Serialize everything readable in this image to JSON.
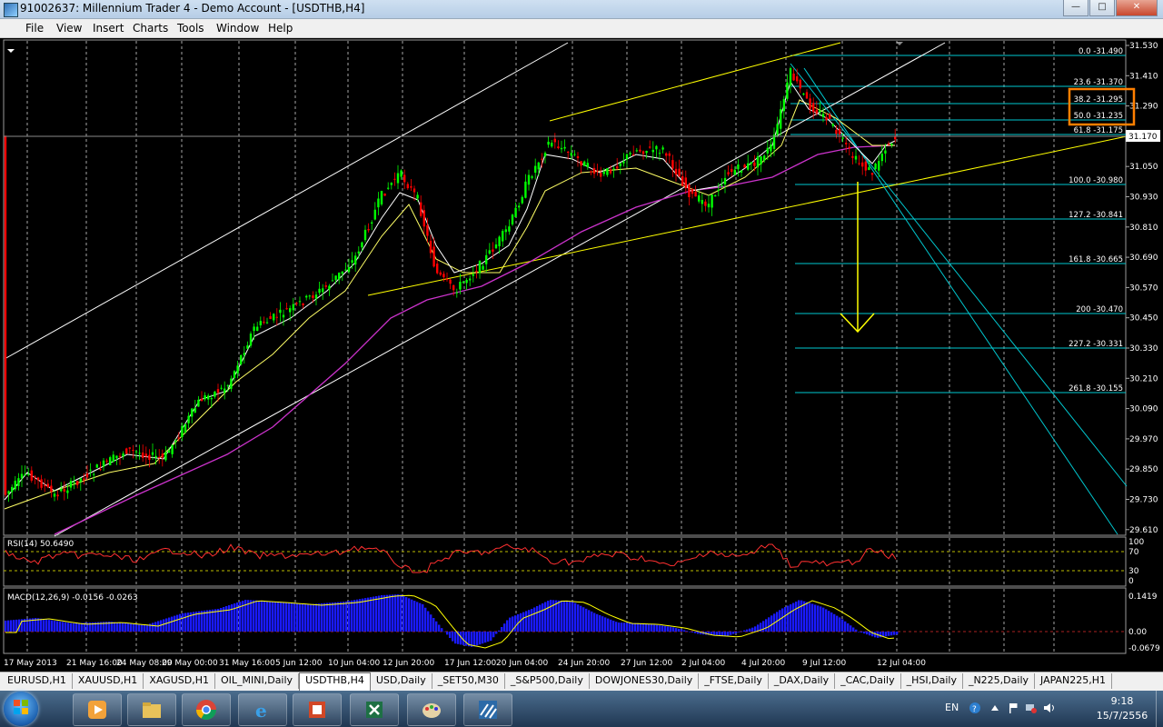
{
  "window": {
    "title": "91002637: Millennium Trader 4 - Demo Account - [USDTHB,H4]"
  },
  "menu": [
    "File",
    "View",
    "Insert",
    "Charts",
    "Tools",
    "Window",
    "Help"
  ],
  "chart": {
    "price_ticks": [
      "31.530",
      "31.410",
      "31.290",
      "31.170",
      "31.050",
      "30.930",
      "30.810",
      "30.690",
      "30.570",
      "30.450",
      "30.330",
      "30.210",
      "30.090",
      "29.970",
      "29.850",
      "29.730",
      "29.610"
    ],
    "current_price": "31.170",
    "fib_labels": [
      "0.0 -31.490",
      "23.6 -31.370",
      "38.2 -31.295",
      "50.0 -31.235",
      "61.8 -31.175",
      "100.0 -30.980",
      "127.2 -30.841",
      "161.8 -30.665",
      "200 -30.470",
      "227.2 -30.331",
      "261.8 -30.155"
    ],
    "rsi": {
      "label": "RSI(14) 50.6490",
      "ticks": [
        "100",
        "70",
        "30",
        "0"
      ]
    },
    "macd": {
      "label": "MACD(12,26,9) -0.0156 -0.0263",
      "ticks": [
        "0.1419",
        "0.00",
        "-0.0679"
      ]
    },
    "time_labels": [
      "17 May 2013",
      "21 May 16:00",
      "24 May 08:00",
      "29 May 00:00",
      "31 May 16:00",
      "5 Jun 12:00",
      "10 Jun 04:00",
      "12 Jun 20:00",
      "17 Jun 12:00",
      "20 Jun 04:00",
      "24 Jun 20:00",
      "27 Jun 12:00",
      "2 Jul 04:00",
      "4 Jul 20:00",
      "9 Jul 12:00",
      "12 Jul 04:00"
    ],
    "colors": {
      "bull": "#00ff00",
      "bear": "#ff0000",
      "fib": "#00c8d0",
      "trend": "#ffff00",
      "ma_slow": "#cc33cc",
      "macd_hist": "#1a1aff",
      "highlight": "#ff7f00"
    }
  },
  "tabs": [
    "EURUSD,H1",
    "XAUUSD,H1",
    "XAGUSD,H1",
    "OIL_MINI,Daily",
    "USDTHB,H4",
    "USD,Daily",
    "_SET50,M30",
    "_S&P500,Daily",
    "DOWJONES30,Daily",
    "_FTSE,Daily",
    "_DAX,Daily",
    "_CAC,Daily",
    "_HSI,Daily",
    "_N225,Daily",
    "JAPAN225,H1"
  ],
  "active_tab": "USDTHB,H4",
  "taskbar": {
    "items": [
      "media-player-icon",
      "folder-icon",
      "chrome-icon",
      "ie-icon",
      "powerpoint-icon",
      "excel-icon",
      "paint-icon",
      "trader-icon"
    ],
    "lang": "EN",
    "time": "9:18",
    "date": "15/7/2556"
  }
}
